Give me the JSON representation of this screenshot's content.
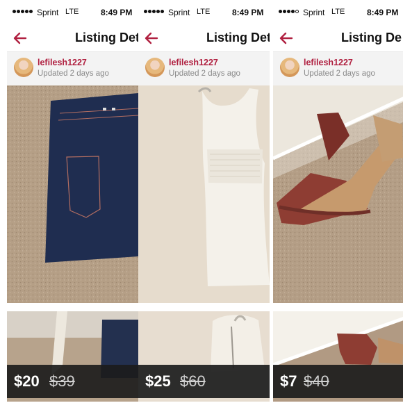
{
  "listings": [
    {
      "status": {
        "carrier": "Sprint",
        "network": "LTE",
        "time": "8:49 PM"
      },
      "nav": {
        "title": "Listing Det"
      },
      "seller": {
        "username": "lefilesh1227",
        "updated": "Updated 2 days ago"
      },
      "pricing": {
        "price": "$20",
        "original_price": "$39"
      }
    },
    {
      "status": {
        "carrier": "Sprint",
        "network": "LTE",
        "time": "8:49 PM"
      },
      "nav": {
        "title": "Listing Det"
      },
      "seller": {
        "username": "lefilesh1227",
        "updated": "Updated 2 days ago"
      },
      "pricing": {
        "price": "$25",
        "original_price": "$60"
      }
    },
    {
      "status": {
        "carrier": "Sprint",
        "network": "LTE",
        "time": "8:49 PM"
      },
      "nav": {
        "title": "Listing De"
      },
      "seller": {
        "username": "lefilesh1227",
        "updated": "Updated 2 days ago"
      },
      "pricing": {
        "price": "$7",
        "original_price": "$40"
      }
    }
  ],
  "icons": {
    "back": "back-arrow-icon"
  },
  "colors": {
    "brand": "#b02040",
    "price_bar": "#1c1c1c"
  }
}
